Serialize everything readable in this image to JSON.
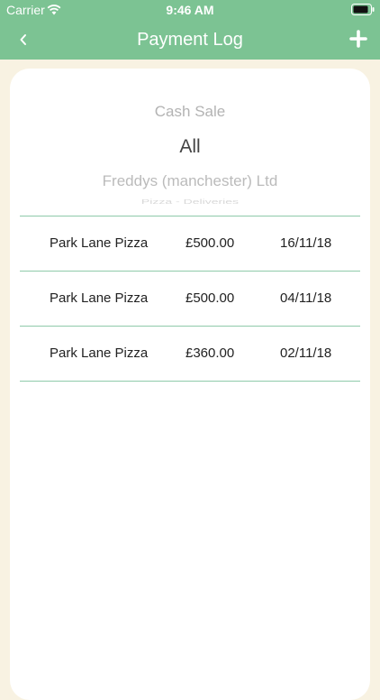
{
  "status_bar": {
    "carrier": "Carrier",
    "time": "9:46 AM",
    "wifi_icon": "wifi-icon",
    "battery_icon": "battery-icon"
  },
  "nav": {
    "title": "Payment Log",
    "back_icon": "chevron-left-icon",
    "add_icon": "plus-icon"
  },
  "filter_picker": {
    "options": [
      "Cash Sale",
      "All",
      "Freddys (manchester) Ltd",
      "Pizza - Deliveries"
    ],
    "selected": "All"
  },
  "payments": [
    {
      "name": "Park Lane Pizza",
      "amount": "£500.00",
      "date": "16/11/18"
    },
    {
      "name": "Park Lane Pizza",
      "amount": "£500.00",
      "date": "04/11/18"
    },
    {
      "name": "Park Lane Pizza",
      "amount": "£360.00",
      "date": "02/11/18"
    }
  ],
  "colors": {
    "header": "#7cc393",
    "background": "#f8f2e2",
    "divider": "#8fcaaa"
  }
}
